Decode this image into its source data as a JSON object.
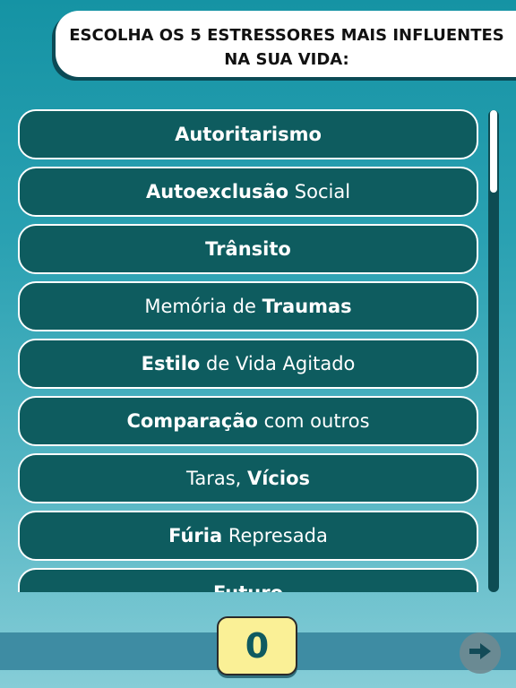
{
  "header": {
    "title_line1": "ESCOLHA OS 5 ESTRESSORES MAIS INFLUENTES",
    "title_line2": "NA SUA VIDA:"
  },
  "options": [
    {
      "bold": "Autoritarismo",
      "regular": ""
    },
    {
      "bold": "Autoexclusão",
      "regular": " Social"
    },
    {
      "bold": "Trânsito",
      "regular": ""
    },
    {
      "pre": "Memória de ",
      "bold": "Traumas"
    },
    {
      "bold": "Estilo",
      "regular": " de Vida Agitado"
    },
    {
      "bold": "Comparação",
      "regular": " com outros"
    },
    {
      "pre": "Taras, ",
      "bold": "Vícios"
    },
    {
      "bold": "Fúria",
      "regular": " Represada"
    },
    {
      "bold": "Futuro",
      "regular": ""
    }
  ],
  "counter": {
    "value": "0"
  },
  "icons": {
    "next": "arrow-right-icon"
  },
  "colors": {
    "option_bg": "#0e5c5f",
    "counter_bg": "#faf096",
    "counter_text": "#0f5a60"
  }
}
